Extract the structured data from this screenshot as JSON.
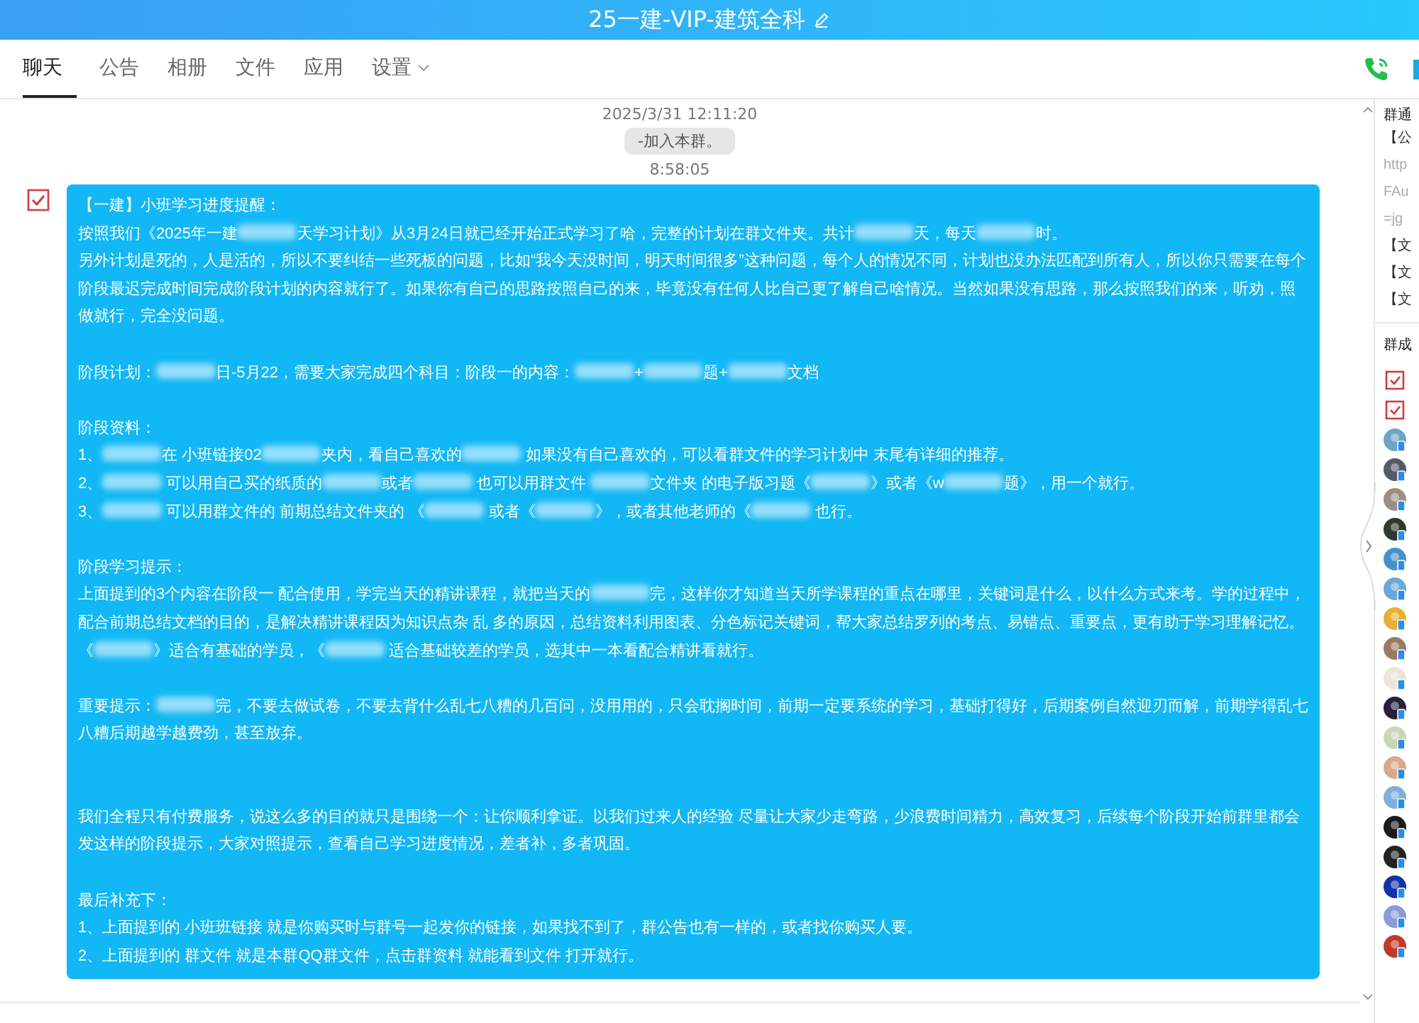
{
  "window": {
    "title": "25一建-VIP-建筑全科"
  },
  "tabs": [
    {
      "label": "聊天",
      "selected": true
    },
    {
      "label": "公告",
      "selected": false
    },
    {
      "label": "相册",
      "selected": false
    },
    {
      "label": "文件",
      "selected": false
    },
    {
      "label": "应用",
      "selected": false
    },
    {
      "label": "设置",
      "selected": false,
      "dropdown": true
    }
  ],
  "chat": {
    "timestamp": "2025/3/31 12:11:20",
    "system_notice": "-加入本群。",
    "message_time": "8:58:05",
    "message": {
      "blocks": [
        [
          [
            "【一建】小班学习进度提醒："
          ],
          [
            "按照我们《2025年一建",
            {
              "kind": "blur"
            },
            "天学习计划》从3月24日就已经开始正式学习了哈，完整的计划在群文件夹。共计",
            {
              "kind": "blur"
            },
            "天，每天",
            {
              "kind": "blur"
            },
            "时。"
          ],
          [
            "另外计划是死的，人是活的，所以不要纠结一些死板的问题，比如“我今天没时间，明天时间很多”这种问题，每个人的情况不同，计划也没办法匹配到所有人，所以你只需要在每个阶段最迟完成时间完成阶段计划的内容就行了。如果你有自己的思路按照自己的来，毕竟没有任何人比自己更了解自己啥情况。当然如果没有思路，那么按照我们的来，听劝，照做就行，完全没问题。"
          ]
        ],
        [
          [
            "阶段计划：",
            {
              "kind": "blur"
            },
            "日-5月22，需要大家完成四个科目：阶段一的内容：",
            {
              "kind": "blur"
            },
            "+",
            {
              "kind": "blur"
            },
            "题+",
            {
              "kind": "blur"
            },
            "文档"
          ]
        ],
        [
          [
            "阶段资料："
          ],
          [
            "1、",
            {
              "kind": "blur"
            },
            "在 小班链接02",
            {
              "kind": "blur"
            },
            "夹内，看自己喜欢的",
            {
              "kind": "blur"
            },
            " 如果没有自己喜欢的，可以看群文件的学习计划中 末尾有详细的推荐。"
          ],
          [
            "2、",
            {
              "kind": "blur"
            },
            " 可以用自己买的纸质的",
            {
              "kind": "blur"
            },
            "或者",
            {
              "kind": "blur"
            },
            " 也可以用群文件 ",
            {
              "kind": "blur"
            },
            "文件夹 的电子版习题《",
            {
              "kind": "blur"
            },
            "》或者《w",
            {
              "kind": "blur"
            },
            "题》，用一个就行。"
          ],
          [
            "3、",
            {
              "kind": "blur"
            },
            " 可以用群文件的 前期总结文件夹的 《",
            {
              "kind": "blur"
            },
            " 或者《",
            {
              "kind": "blur"
            },
            "》，或者其他老师的《",
            {
              "kind": "blur"
            },
            " 也行。"
          ]
        ],
        [
          [
            "阶段学习提示："
          ],
          [
            "上面提到的3个内容在阶段一 配合使用，学完当天的精讲课程，就把当天的",
            {
              "kind": "blur"
            },
            "完，这样你才知道当天所学课程的重点在哪里，关键词是什么，以什么方式来考。学的过程中，配合前期总结文档的目的，是解决精讲课程因为知识点杂 乱 多的原因，总结资料利用图表、分色标记关键词，帮大家总结罗列的考点、易错点、重要点，更有助于学习理解记忆。《",
            {
              "kind": "blur"
            },
            "》适合有基础的学员，《",
            {
              "kind": "blur"
            },
            " 适合基础较差的学员，选其中一本看配合精讲看就行。"
          ]
        ],
        [
          [
            "重要提示：",
            {
              "kind": "blur"
            },
            "完，不要去做试卷，不要去背什么乱七八糟的几百问，没用用的，只会耽搁时间，前期一定要系统的学习，基础打得好，后期案例自然迎刃而解，前期学得乱七八糟后期越学越费劲，甚至放弃。"
          ]
        ],
        [
          [
            "我们全程只有付费服务，说这么多的目的就只是围绕一个：让你顺利拿证。以我们过来人的经验 尽量让大家少走弯路，少浪费时间精力，高效复习，后续每个阶段开始前群里都会发这样的阶段提示，大家对照提示，查看自己学习进度情况，差者补，多者巩固。"
          ]
        ],
        [
          [
            "最后补充下："
          ],
          [
            "1、上面提到的 小班班链接 就是你购买时与群号一起发你的链接，如果找不到了，群公告也有一样的，或者找你购买人要。"
          ],
          [
            " 2、上面提到的 群文件 就是本群QQ群文件，点击群资料  就能看到文件  打开就行。"
          ]
        ]
      ]
    }
  },
  "side_panel": {
    "notice_title": "群通",
    "notice_lines": [
      "【公",
      "http",
      "FAu",
      "=jg"
    ],
    "files": [
      "【文",
      "【文",
      "【文"
    ],
    "members_title": "群成",
    "members": [
      {
        "kind": "badge"
      },
      {
        "kind": "badge"
      },
      {
        "kind": "avatar"
      },
      {
        "kind": "avatar"
      },
      {
        "kind": "avatar"
      },
      {
        "kind": "avatar"
      },
      {
        "kind": "avatar"
      },
      {
        "kind": "avatar"
      },
      {
        "kind": "avatar"
      },
      {
        "kind": "avatar"
      },
      {
        "kind": "avatar"
      },
      {
        "kind": "avatar"
      },
      {
        "kind": "avatar"
      },
      {
        "kind": "avatar"
      },
      {
        "kind": "avatar"
      },
      {
        "kind": "avatar"
      },
      {
        "kind": "avatar"
      },
      {
        "kind": "avatar"
      },
      {
        "kind": "avatar"
      },
      {
        "kind": "avatar"
      }
    ]
  }
}
